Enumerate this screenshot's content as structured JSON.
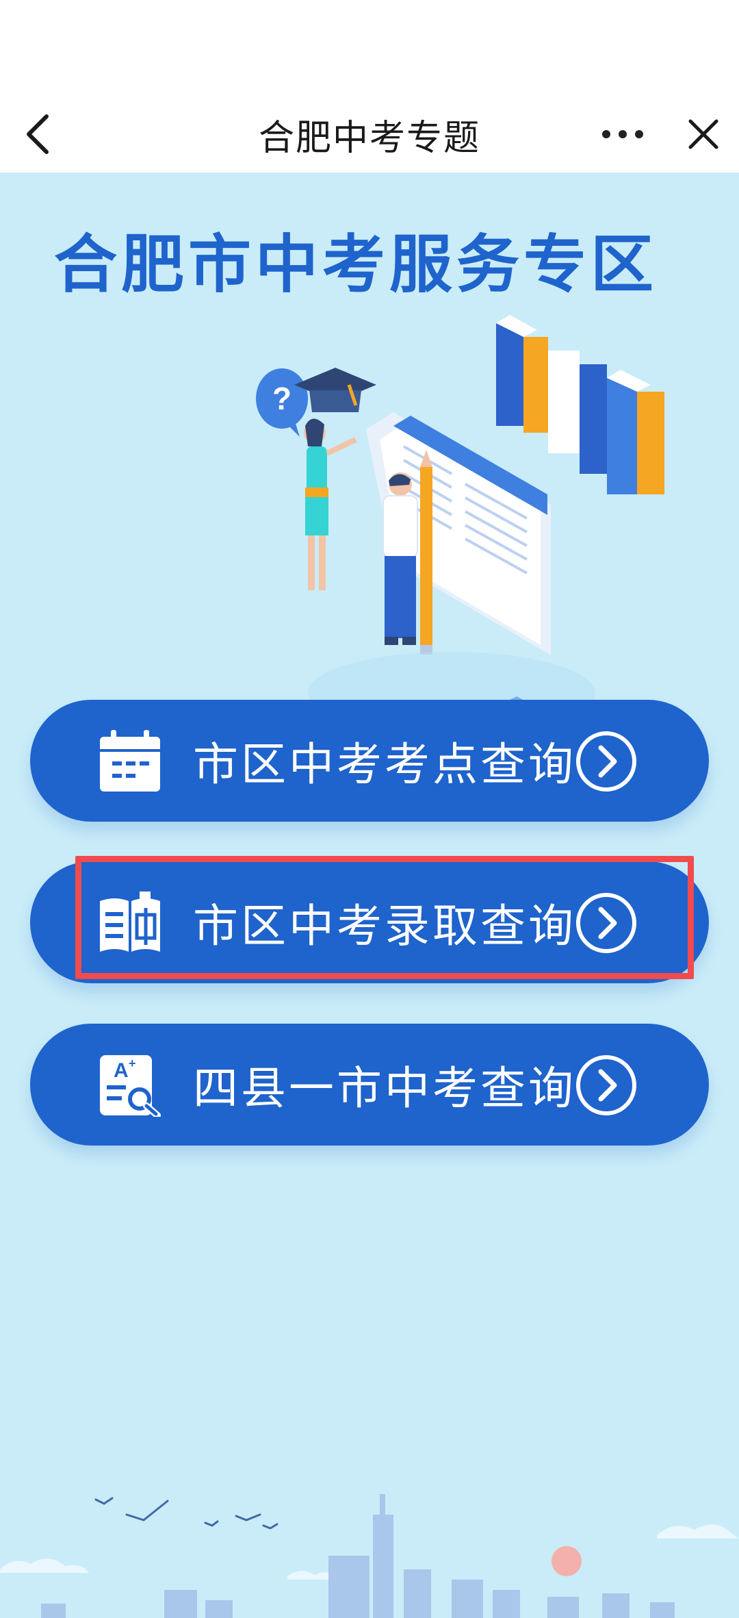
{
  "nav": {
    "title": "合肥中考专题",
    "back_icon": "back-chevron-icon",
    "more_icon": "more-dots-icon",
    "close_icon": "close-icon"
  },
  "hero": {
    "title": "合肥市中考服务专区"
  },
  "buttons": [
    {
      "label": "市区中考考点查询",
      "icon": "calendar-icon"
    },
    {
      "label": "市区中考录取查询",
      "icon": "book-icon"
    },
    {
      "label": "四县一市中考查询",
      "icon": "grade-search-icon"
    }
  ],
  "colors": {
    "background": "#c9ecf8",
    "primary": "#1f63cc",
    "highlight": "#f04b4f",
    "navbar": "#ffffff"
  },
  "highlighted_button_index": 1
}
